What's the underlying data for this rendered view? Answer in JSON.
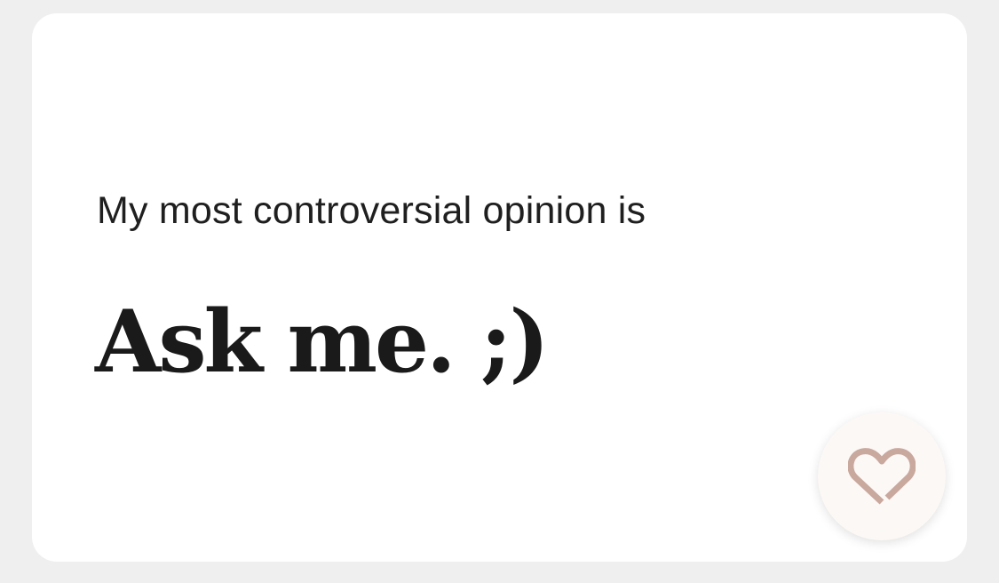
{
  "card": {
    "prompt": "My most controversial opinion is",
    "answer": "Ask me. ;)"
  },
  "like_button": {
    "icon": "heart-icon",
    "icon_color": "#c9a89e",
    "background": "#fcf8f6"
  }
}
